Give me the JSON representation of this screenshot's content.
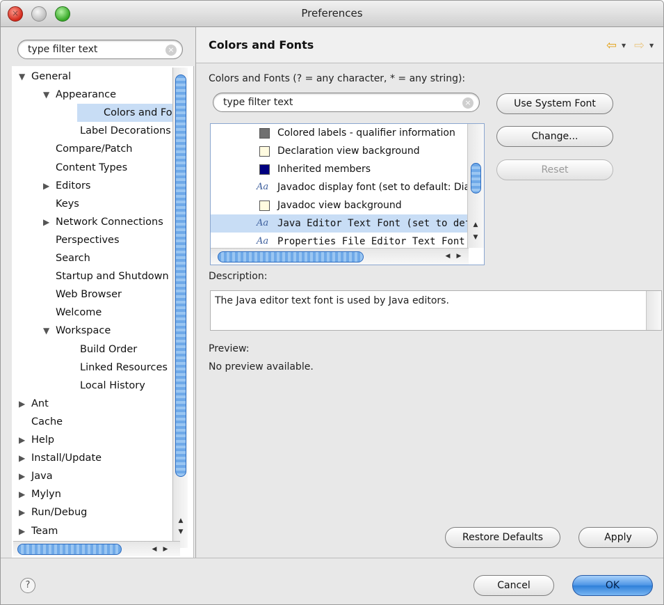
{
  "window": {
    "title": "Preferences"
  },
  "left": {
    "filter_placeholder": "type filter text",
    "tree": [
      {
        "label": "General",
        "twisty": "▼",
        "indent": 0
      },
      {
        "label": "Appearance",
        "twisty": "▼",
        "indent": 1
      },
      {
        "label": "Colors and Fonts",
        "twisty": "",
        "indent": 2,
        "selected": true
      },
      {
        "label": "Label Decorations",
        "twisty": "",
        "indent": 2
      },
      {
        "label": "Compare/Patch",
        "twisty": "",
        "indent": 1
      },
      {
        "label": "Content Types",
        "twisty": "",
        "indent": 1
      },
      {
        "label": "Editors",
        "twisty": "▶",
        "indent": 1
      },
      {
        "label": "Keys",
        "twisty": "",
        "indent": 1
      },
      {
        "label": "Network Connections",
        "twisty": "▶",
        "indent": 1
      },
      {
        "label": "Perspectives",
        "twisty": "",
        "indent": 1
      },
      {
        "label": "Search",
        "twisty": "",
        "indent": 1
      },
      {
        "label": "Startup and Shutdown",
        "twisty": "",
        "indent": 1
      },
      {
        "label": "Web Browser",
        "twisty": "",
        "indent": 1
      },
      {
        "label": "Welcome",
        "twisty": "",
        "indent": 1
      },
      {
        "label": "Workspace",
        "twisty": "▼",
        "indent": 1
      },
      {
        "label": "Build Order",
        "twisty": "",
        "indent": 2
      },
      {
        "label": "Linked Resources",
        "twisty": "",
        "indent": 2
      },
      {
        "label": "Local History",
        "twisty": "",
        "indent": 2
      },
      {
        "label": "Ant",
        "twisty": "▶",
        "indent": 0
      },
      {
        "label": "Cache",
        "twisty": "",
        "indent": 0
      },
      {
        "label": "Help",
        "twisty": "▶",
        "indent": 0
      },
      {
        "label": "Install/Update",
        "twisty": "▶",
        "indent": 0
      },
      {
        "label": "Java",
        "twisty": "▶",
        "indent": 0
      },
      {
        "label": "Mylyn",
        "twisty": "▶",
        "indent": 0
      },
      {
        "label": "Run/Debug",
        "twisty": "▶",
        "indent": 0
      },
      {
        "label": "Team",
        "twisty": "▶",
        "indent": 0
      }
    ]
  },
  "right": {
    "header_title": "Colors and Fonts",
    "intro_label": "Colors and Fonts (? = any character, * = any string):",
    "filter_placeholder": "type filter text",
    "items": [
      {
        "kind": "swatch",
        "color": "#707070",
        "label": "Colored labels - qualifier information"
      },
      {
        "kind": "swatch",
        "color": "#fffbe0",
        "label": "Declaration view background"
      },
      {
        "kind": "swatch",
        "color": "#000080",
        "label": "Inherited members"
      },
      {
        "kind": "font",
        "label": "Javadoc display font (set to default: Dialog)"
      },
      {
        "kind": "swatch",
        "color": "#fffbe0",
        "label": "Javadoc view background"
      },
      {
        "kind": "font",
        "label": "Java Editor Text Font (set to default: Text Font)",
        "selected": true,
        "mono": true
      },
      {
        "kind": "font",
        "label": "Properties File Editor Text Font (set to default: Text Font)",
        "mono": true
      }
    ],
    "buttons": {
      "use_system_font": "Use System Font",
      "change": "Change...",
      "reset": "Reset"
    },
    "description_label": "Description:",
    "description_text": "The Java editor text font is used by Java editors.",
    "preview_label": "Preview:",
    "preview_text": "No preview available.",
    "restore_defaults": "Restore Defaults",
    "apply": "Apply"
  },
  "footer": {
    "help_symbol": "?",
    "cancel": "Cancel",
    "ok": "OK"
  }
}
